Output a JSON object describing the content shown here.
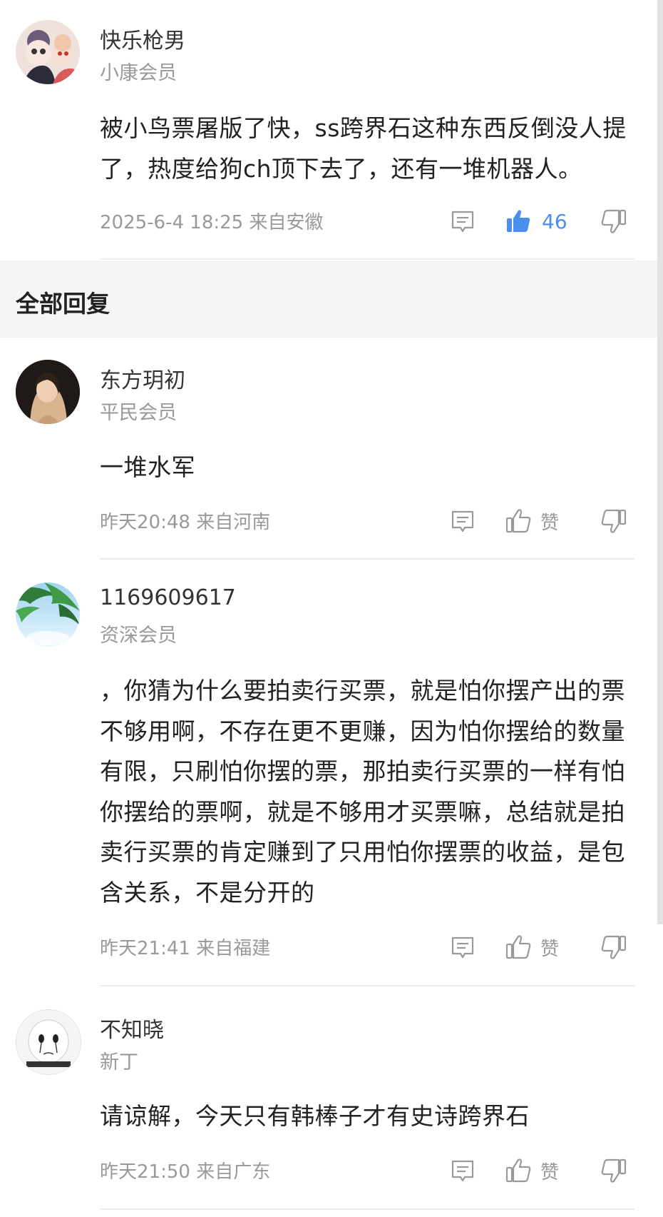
{
  "top_comment": {
    "username": "快乐枪男",
    "level": "小康会员",
    "content": "被小鸟票屠版了快，ss跨界石这种东西反倒没人提了，热度给狗ch顶下去了，还有一堆机器人。",
    "meta": "2025-6-4 18:25  来自安徽",
    "likes": "46"
  },
  "section": {
    "title": "全部回复"
  },
  "replies": [
    {
      "username": "东方玥初",
      "level": "平民会员",
      "content": "一堆水军",
      "meta": "昨天20:48 来自河南",
      "like_label": "赞"
    },
    {
      "username": "1169609617",
      "level": "资深会员",
      "content": "，你猜为什么要拍卖行买票，就是怕你摆产出的票不够用啊，不存在更不更赚，因为怕你摆给的数量有限，只刷怕你摆的票，那拍卖行买票的一样有怕你摆给的票啊，就是不够用才买票嘛，总结就是拍卖行买票的肯定赚到了只用怕你摆票的收益，是包含关系，不是分开的",
      "meta": "昨天21:41 来自福建",
      "like_label": "赞"
    },
    {
      "username": "不知晓",
      "level": "新丁",
      "content": "请谅解，今天只有韩棒子才有史诗跨界石",
      "meta": "昨天21:50 来自广东",
      "like_label": "赞"
    }
  ],
  "icons": {
    "comment": "comment-icon",
    "like": "thumbs-up-icon",
    "dislike": "thumbs-down-icon"
  },
  "colors": {
    "accent": "#4a8ef0",
    "muted": "#999999",
    "section_bg": "#f5f5f5"
  }
}
